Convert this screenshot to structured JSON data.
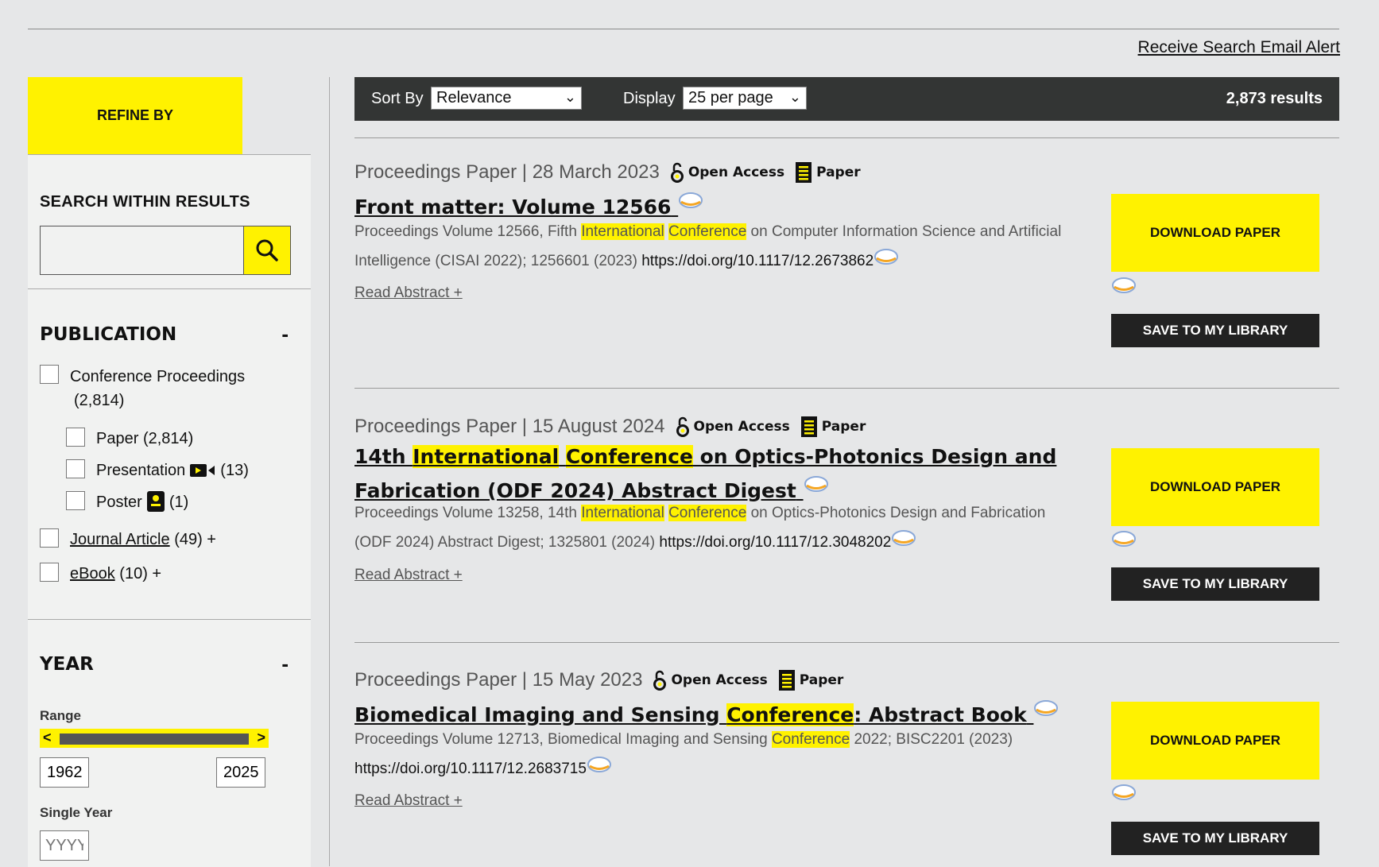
{
  "header": {
    "email_alert": "Receive Search Email Alert"
  },
  "sidebar": {
    "refine_by": "REFINE BY",
    "search_within": {
      "title": "SEARCH WITHIN RESULTS",
      "value": ""
    },
    "publication": {
      "title": "PUBLICATION",
      "collapse": "-",
      "items": [
        {
          "label": "Conference Proceedings",
          "count": "(2,814)"
        },
        {
          "label": "Paper",
          "count": "(2,814)"
        },
        {
          "label": "Presentation",
          "count": "(13)"
        },
        {
          "label": "Poster",
          "count": "(1)"
        },
        {
          "label": "Journal Article",
          "count": "(49) +"
        },
        {
          "label": "eBook",
          "count": "(10) +"
        }
      ]
    },
    "year": {
      "title": "YEAR",
      "collapse": "-",
      "range_label": "Range",
      "handle_left": "<",
      "handle_right": ">",
      "from": "1962",
      "to": "2025",
      "single_label": "Single Year",
      "single_placeholder": "YYYY"
    }
  },
  "toolbar": {
    "sort_label": "Sort By",
    "sort_value": "Relevance",
    "display_label": "Display",
    "display_value": "25 per page",
    "results": "2,873 results"
  },
  "badges": {
    "open_access": "Open Access",
    "paper": "Paper"
  },
  "buttons": {
    "download": "DOWNLOAD PAPER",
    "save": "SAVE TO MY LIBRARY",
    "read_abstract": "Read Abstract +"
  },
  "results": [
    {
      "meta": "Proceedings Paper | 28 March 2023",
      "title": {
        "a": "Front matter: Volume 12566",
        "hl1": "",
        "b": "",
        "hl2": "",
        "c": ""
      },
      "desc": {
        "a": "Proceedings Volume 12566, Fifth ",
        "hl1": "International",
        "b": " ",
        "hl2": "Conference",
        "c": " on Computer Information Science and Artificial Intelligence (CISAI 2022); 1256601 (2023) ",
        "doi": "https://doi.org/10.1117/12.2673862"
      }
    },
    {
      "meta": "Proceedings Paper | 15 August 2024",
      "title": {
        "a": "14th ",
        "hl1": "International",
        "b": " ",
        "hl2": "Conference",
        "c": " on Optics-Photonics Design and Fabrication (ODF 2024) Abstract Digest"
      },
      "desc": {
        "a": "Proceedings Volume 13258, 14th ",
        "hl1": "International",
        "b": " ",
        "hl2": "Conference",
        "c": " on Optics-Photonics Design and Fabrication (ODF 2024) Abstract Digest; 1325801 (2024) ",
        "doi": "https://doi.org/10.1117/12.3048202"
      }
    },
    {
      "meta": "Proceedings Paper | 15 May 2023",
      "title": {
        "a": "Biomedical Imaging and Sensing ",
        "hl1": "Conference",
        "b": ": Abstract Book",
        "hl2": "",
        "c": ""
      },
      "desc": {
        "a": "Proceedings Volume 12713, Biomedical Imaging and Sensing ",
        "hl1": "Conference",
        "b": " 2022; BISC2201 (2023) ",
        "hl2": "",
        "c": "",
        "doi": "https://doi.org/10.1117/12.2683715"
      }
    }
  ]
}
